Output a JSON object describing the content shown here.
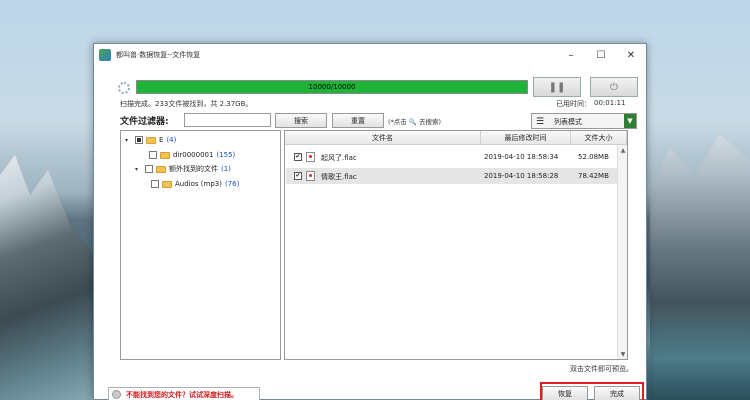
{
  "window": {
    "title": "都叫兽·数据恢复--文件恢复",
    "minimize": "–",
    "maximize": "☐",
    "close": "✕"
  },
  "scan": {
    "progress_text": "10000/10000",
    "progress_percent": 100,
    "status": "扫描完成。233文件被找到，共 2.37GB。",
    "elapsed_label": "已用时间：",
    "elapsed_value": "00:01:11",
    "pause_icon": "pause-icon",
    "stop_icon": "stop-icon"
  },
  "filter": {
    "label": "文件过滤器:",
    "input_value": "",
    "search_button": "搜索",
    "reset_button": "重置",
    "hint": "(*点击 🔍 去搜索)",
    "view_mode": "列表模式"
  },
  "tree": {
    "nodes": [
      {
        "name": "E",
        "count": "(4)"
      },
      {
        "name": "dir0000001",
        "count": "(155)"
      },
      {
        "name": "额外找到的文件",
        "count": "(1)"
      },
      {
        "name": "Audios (mp3)",
        "count": "(76)"
      }
    ]
  },
  "files": {
    "columns": [
      "文件名",
      "最后修改时间",
      "文件大小"
    ],
    "rows": [
      {
        "name": "起风了.flac",
        "modified": "2019-04-10 18:58:34",
        "size": "52.08MB",
        "checked": true
      },
      {
        "name": "情歌王.flac",
        "modified": "2019-04-10 18:58:28",
        "size": "78.42MB",
        "checked": true
      }
    ],
    "dblclick_hint": "双击文件即可预览。"
  },
  "footer": {
    "deep_scan": "不能找到您的文件？试试深度扫描。",
    "recover_button": "恢复",
    "finish_button": "完成"
  },
  "colors": {
    "progress_green": "#1fb33a",
    "highlight_red": "#e02020"
  }
}
